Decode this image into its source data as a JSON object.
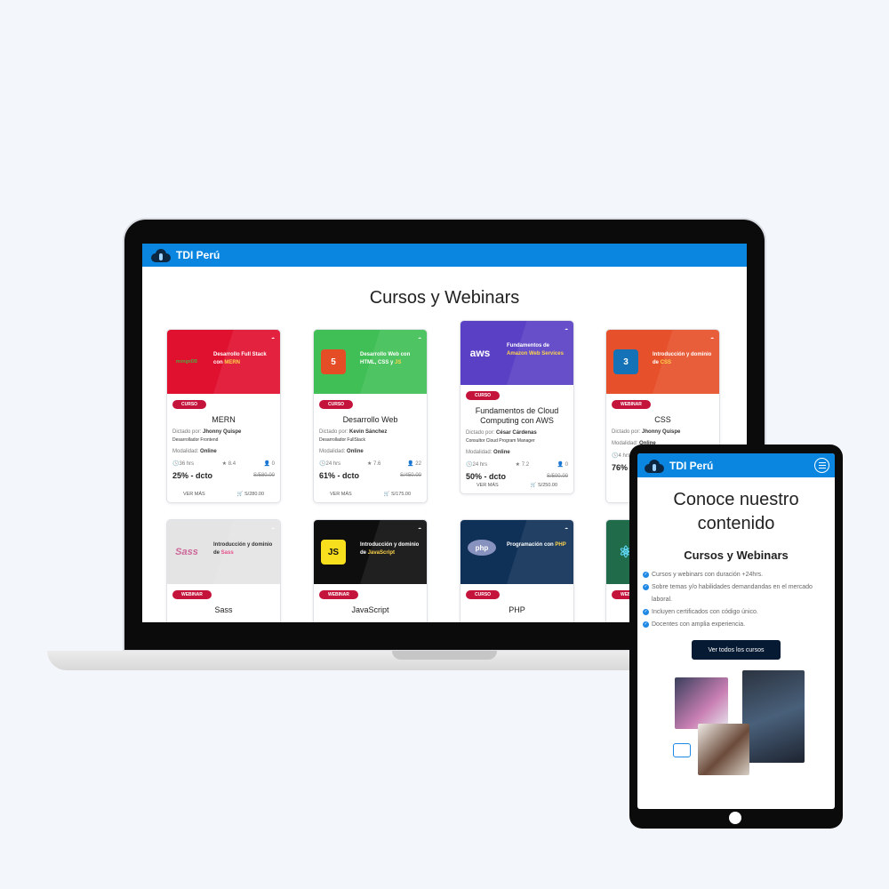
{
  "brand": "TDI Perú",
  "laptop": {
    "section_title": "Cursos y Webinars",
    "cards": [
      {
        "tag": "CURSO",
        "name": "MERN",
        "label_by": "Dictado por:",
        "teacher": "Jhonny Quispe",
        "role": "Desarrollador Frontend",
        "label_mode": "Modalidad:",
        "mode": "Online",
        "hours": "36 hrs",
        "rating": "8.4",
        "students": "0",
        "discount": "25% - dcto",
        "old_price": "S/580.00",
        "more": "VER MÁS",
        "price": "S/280.00",
        "banner_color": "#e0102f",
        "banner_title": "Desarrollo Full Stack con ",
        "banner_hl": "MERN",
        "tech": "mongo",
        "tech_text": "mongoDB"
      },
      {
        "tag": "CURSO",
        "name": "Desarrollo Web",
        "label_by": "Dictado por:",
        "teacher": "Kevin Sánchez",
        "role": "Desarrollador FullStack",
        "label_mode": "Modalidad:",
        "mode": "Online",
        "hours": "24 hrs",
        "rating": "7.6",
        "students": "22",
        "discount": "61% - dcto",
        "old_price": "S/450.00",
        "more": "VER MÁS",
        "price": "S/175.00",
        "banner_color": "#3fbf55",
        "banner_title": "Desarrollo Web con HTML, CSS y ",
        "banner_hl": "JS",
        "tech": "html",
        "tech_text": "5"
      },
      {
        "tag": "CURSO",
        "name": "Fundamentos de Cloud Computing con AWS",
        "label_by": "Dictado por:",
        "teacher": "César Cárdenas",
        "role": "Consultor Cloud Program Manager",
        "label_mode": "Modalidad:",
        "mode": "Online",
        "hours": "24 hrs",
        "rating": "7.2",
        "students": "0",
        "discount": "50% - dcto",
        "old_price": "S/500.00",
        "more": "VER MÁS",
        "price": "S/250.00",
        "banner_color": "#5a40c4",
        "banner_title": "Fundamentos de ",
        "banner_hl": "Amazon Web Services",
        "tech": "aws",
        "tech_text": "aws"
      },
      {
        "tag": "WEBINAR",
        "name": "CSS",
        "label_by": "Dictado por:",
        "teacher": "Jhonny Quispe",
        "role": "",
        "label_mode": "Modalidad:",
        "mode": "Online",
        "hours": "4 hrs",
        "rating": "",
        "students": "",
        "discount": "76%",
        "old_price": "",
        "more": "",
        "price": "",
        "banner_color": "#e6502a",
        "banner_title": "Introducción y dominio de ",
        "banner_hl": "CSS",
        "tech": "css",
        "tech_text": "3"
      },
      {
        "tag": "WEBINAR",
        "name": "Sass",
        "banner_color": "#e4e4e4",
        "banner_title": "Introducción y dominio de ",
        "banner_hl": "Sass",
        "tech": "sass",
        "tech_text": "Sass"
      },
      {
        "tag": "WEBINAR",
        "name": "JavaScript",
        "banner_color": "#0e0e0e",
        "banner_title": "Introducción y dominio de ",
        "banner_hl": "JavaScript",
        "tech": "js",
        "tech_text": "JS"
      },
      {
        "tag": "CURSO",
        "name": "PHP",
        "banner_color": "#0f3057",
        "banner_title": "Programación con ",
        "banner_hl": "PHP",
        "tech": "php",
        "tech_text": "php"
      },
      {
        "tag": "WEBINAR",
        "name": "",
        "banner_color": "#1f6b4a",
        "banner_title": "",
        "banner_hl": "",
        "tech": "react",
        "tech_text": "⚛"
      }
    ]
  },
  "tablet": {
    "hero": "Conoce nuestro contenido",
    "subtitle": "Cursos y Webinars",
    "bullets": [
      "Cursos y webinars con duración +24hrs.",
      "Sobre temas y/o habilidades demandandas en el mercado laboral.",
      "Incluyen certificados con código único.",
      "Docentes con amplia experiencia."
    ],
    "cta": "Ver todos los cursos"
  },
  "icons": {
    "clock": "clock-icon",
    "star": "star-icon",
    "user": "user-icon",
    "cart": "cart-icon",
    "check": "check-icon",
    "menu": "hamburger-menu-icon"
  }
}
